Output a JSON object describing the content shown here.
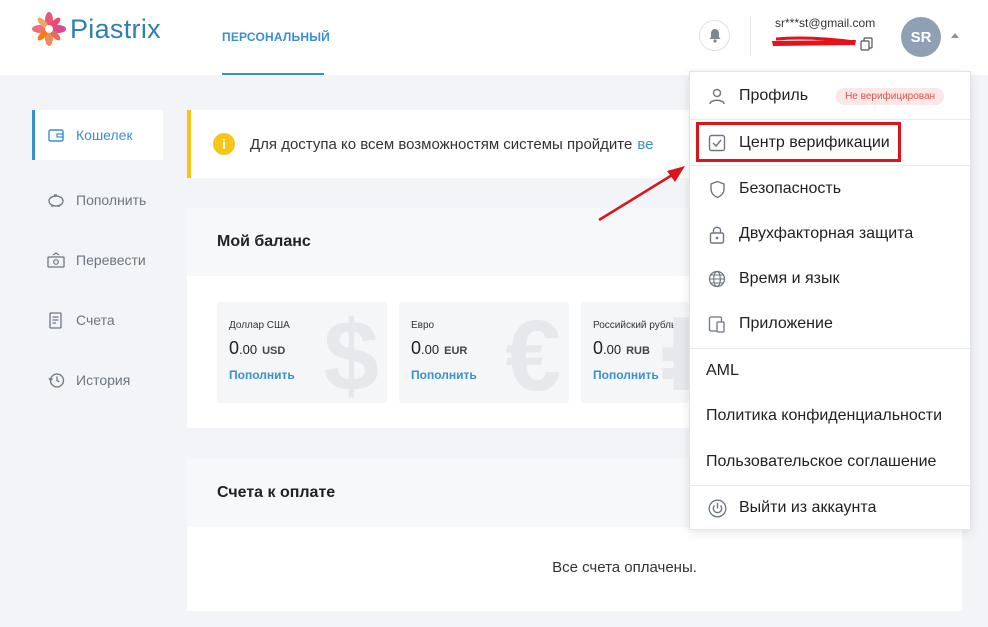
{
  "header": {
    "logo_text": "Piastrix",
    "nav_tab": "ПЕРСОНАЛЬНЫЙ",
    "email": "sr***st@gmail.com",
    "avatar_initials": "SR"
  },
  "sidebar": {
    "items": [
      {
        "label": "Кошелек",
        "icon": "wallet-icon",
        "active": true
      },
      {
        "label": "Пополнить",
        "icon": "piggy-bank-icon"
      },
      {
        "label": "Перевести",
        "icon": "transfer-icon"
      },
      {
        "label": "Счета",
        "icon": "invoice-icon"
      },
      {
        "label": "История",
        "icon": "history-icon"
      }
    ]
  },
  "alert": {
    "text": "Для доступа ко всем возможностям системы пройдите",
    "link": "ве"
  },
  "balance": {
    "title": "Мой баланс",
    "currencies": [
      {
        "name": "Доллар США",
        "int": "0",
        "dec": ".00",
        "code": "USD",
        "action": "Пополнить",
        "symbol": "$"
      },
      {
        "name": "Евро",
        "int": "0",
        "dec": ".00",
        "code": "EUR",
        "action": "Пополнить",
        "symbol": "€"
      },
      {
        "name": "Российский рубль",
        "int": "0",
        "dec": ".00",
        "code": "RUB",
        "action": "Пополнить",
        "symbol": "₽"
      }
    ]
  },
  "bills": {
    "title": "Счета к оплате",
    "empty_text": "Все счета оплачены."
  },
  "menu": {
    "profile": "Профиль",
    "profile_badge": "Не верифицирован",
    "verification": "Центр верификации",
    "security": "Безопасность",
    "twofa": "Двухфакторная защита",
    "time_lang": "Время и язык",
    "app": "Приложение",
    "aml": "AML",
    "privacy": "Политика конфиденциальности",
    "agreement": "Пользовательское соглашение",
    "logout": "Выйти из аккаунта"
  },
  "colors": {
    "accent": "#3a8fcf",
    "highlight": "#d9161b",
    "warning": "#f5c518"
  }
}
